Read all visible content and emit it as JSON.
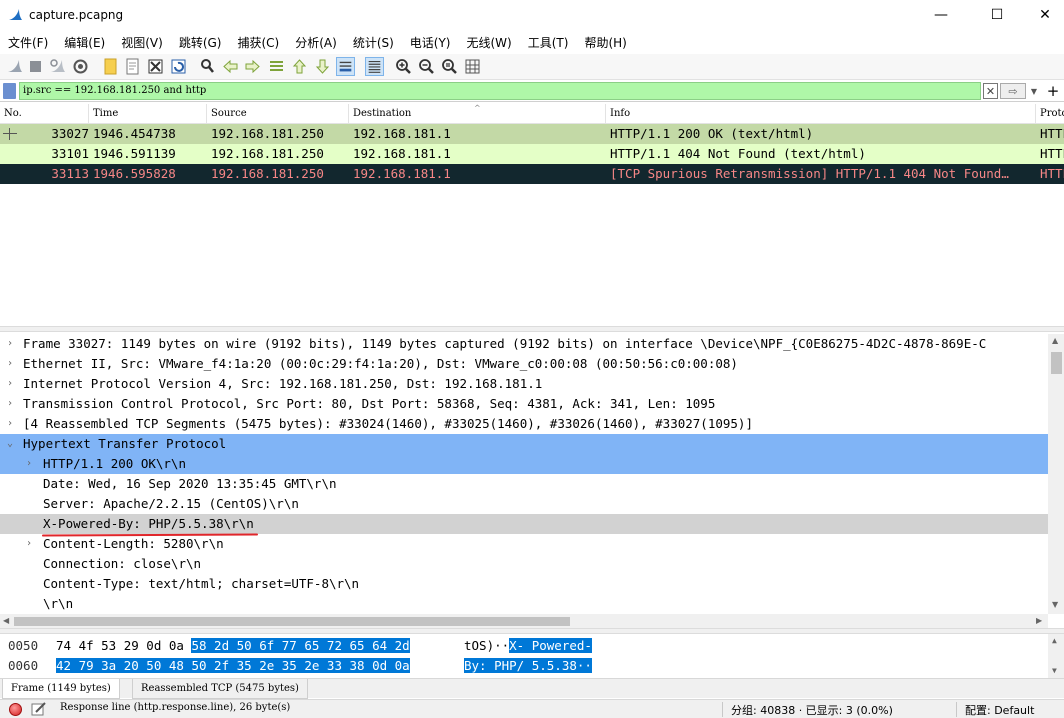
{
  "window": {
    "title": "capture.pcapng",
    "minimize_glyph": "—",
    "maximize_glyph": "☐",
    "close_glyph": "✕"
  },
  "menu": [
    "文件(F)",
    "编辑(E)",
    "视图(V)",
    "跳转(G)",
    "捕获(C)",
    "分析(A)",
    "统计(S)",
    "电话(Y)",
    "无线(W)",
    "工具(T)",
    "帮助(H)"
  ],
  "toolbar_icons": [
    "shark-fin-start-icon",
    "stop-square-icon",
    "restart-fin-icon",
    "capture-options-icon",
    "open-folder-icon",
    "file-icon",
    "close-file-icon",
    "reload-icon",
    "find-icon",
    "back-arrow-icon",
    "forward-arrow-icon",
    "go-to-packet-icon",
    "first-packet-icon",
    "last-packet-icon",
    "autoscroll-icon",
    "colorize-icon",
    "zoom-in-icon",
    "zoom-out-icon",
    "zoom-reset-icon",
    "resize-columns-icon"
  ],
  "filter": {
    "value": "ip.src == 192.168.181.250 and http",
    "clear_glyph": "✕",
    "apply_glyph": "⇨",
    "dropdown_glyph": "▼",
    "add_glyph": "+"
  },
  "packet_list": {
    "columns": [
      "No.",
      "Time",
      "Source",
      "Destination",
      "Info",
      "Proto"
    ],
    "sort_glyph": "^",
    "rows": [
      {
        "no": "33027",
        "time": "1946.454738",
        "source": "192.168.181.250",
        "destination": "192.168.181.1",
        "info": "HTTP/1.1 200 OK  (text/html)",
        "protocol": "HTTP"
      },
      {
        "no": "33101",
        "time": "1946.591139",
        "source": "192.168.181.250",
        "destination": "192.168.181.1",
        "info": "HTTP/1.1 404 Not Found  (text/html)",
        "protocol": "HTTP"
      },
      {
        "no": "33113",
        "time": "1946.595828",
        "source": "192.168.181.250",
        "destination": "192.168.181.1",
        "info": "[TCP Spurious Retransmission] HTTP/1.1 404 Not Found…",
        "protocol": "HTTP"
      }
    ]
  },
  "details": {
    "collapsed_glyph": "›",
    "expanded_glyph": "⌄",
    "rows": [
      "Frame 33027: 1149 bytes on wire (9192 bits), 1149 bytes captured (9192 bits) on interface \\Device\\NPF_{C0E86275-4D2C-4878-869E-C",
      "Ethernet II, Src: VMware_f4:1a:20 (00:0c:29:f4:1a:20), Dst: VMware_c0:00:08 (00:50:56:c0:00:08)",
      "Internet Protocol Version 4, Src: 192.168.181.250, Dst: 192.168.181.1",
      "Transmission Control Protocol, Src Port: 80, Dst Port: 58368, Seq: 4381, Ack: 341, Len: 1095",
      "[4 Reassembled TCP Segments (5475 bytes): #33024(1460), #33025(1460), #33026(1460), #33027(1095)]",
      "Hypertext Transfer Protocol",
      "HTTP/1.1 200 OK\\r\\n",
      "Date: Wed, 16 Sep 2020 13:35:45 GMT\\r\\n",
      "Server: Apache/2.2.15 (CentOS)\\r\\n",
      "X-Powered-By: PHP/5.5.38\\r\\n",
      "Content-Length: 5280\\r\\n",
      "Connection: close\\r\\n",
      "Content-Type: text/html; charset=UTF-8\\r\\n",
      "\\r\\n"
    ]
  },
  "bytes": [
    {
      "offset": "0050",
      "hex_plain": "74 4f 53 29 0d 0a",
      "hex_sel": "58 2d  50 6f 77 65 72 65 64 2d",
      "ascii_plain": "tOS)··",
      "ascii_sel": "X- Powered-"
    },
    {
      "offset": "0060",
      "hex_plain": "",
      "hex_sel": "42 79 3a 20 50 48 50 2f  35 2e 35 2e 33 38 0d 0a",
      "ascii_plain": "",
      "ascii_sel": "By: PHP/ 5.5.38··"
    }
  ],
  "byte_tabs": [
    "Frame (1149 bytes)",
    "Reassembled TCP (5475 bytes)"
  ],
  "status": {
    "field_info": "Response line (http.response.line), 26 byte(s)",
    "packets": "分组: 40838 · 已显示: 3 (0.0%)",
    "profile": "配置: Default"
  },
  "colors": {
    "filter_valid_bg": "#aff7a8",
    "row_selected_bg": "#c3d9a6",
    "row_http_bg": "#e4ffc7",
    "row_bad_tcp_bg": "#12272e",
    "row_bad_tcp_fg": "#f78787",
    "tree_selected_bg": "#80b4f6",
    "bytes_selected_bg": "#0078d7",
    "annotation_underline": "#e0262b"
  }
}
